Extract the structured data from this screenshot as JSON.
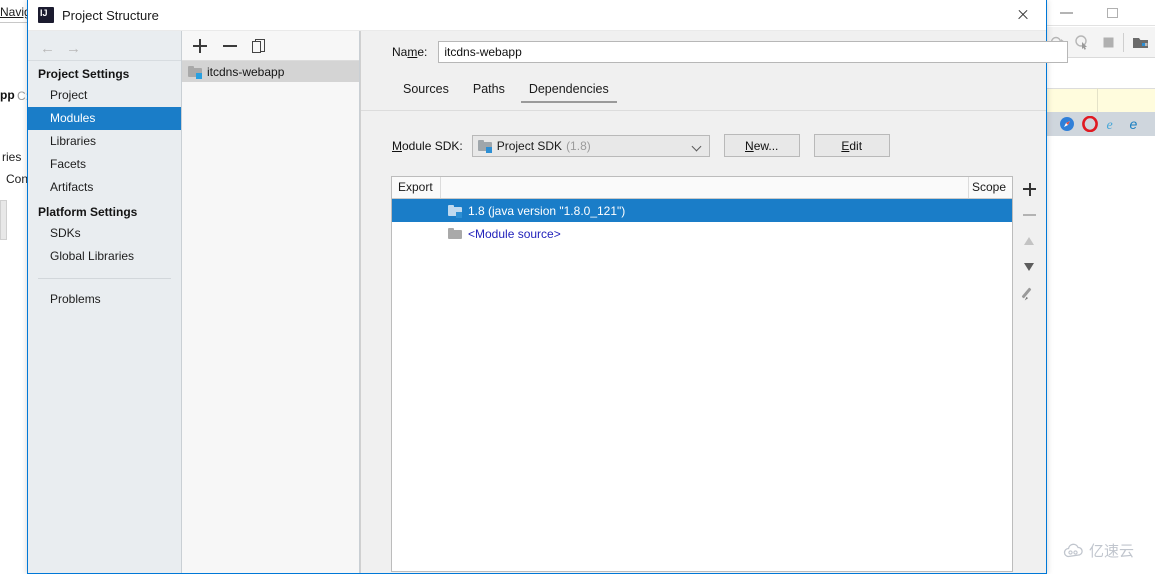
{
  "background": {
    "menu_text": "Navig",
    "bold_fragment": "pp",
    "gray_fragment": "C:",
    "fragment_libraries": "ries",
    "fragment_configure": "Con",
    "toolbar_icons": [
      "debug-step-icon",
      "debug-cursor-icon",
      "stop-icon",
      "folder-icon"
    ],
    "browsers": [
      "safari-browser-icon",
      "opera-browser-icon",
      "ie-browser-icon",
      "edge-browser-icon"
    ],
    "window_buttons": [
      "minimize-button",
      "maximize-button"
    ]
  },
  "watermark": {
    "text": "亿速云"
  },
  "dialog": {
    "title": "Project Structure",
    "close_label": "×",
    "nav": {
      "back_glyph": "←",
      "forward_glyph": "→",
      "groups": [
        {
          "heading": "Project Settings",
          "items": [
            {
              "label": "Project",
              "selected": false
            },
            {
              "label": "Modules",
              "selected": true
            },
            {
              "label": "Libraries",
              "selected": false
            },
            {
              "label": "Facets",
              "selected": false
            },
            {
              "label": "Artifacts",
              "selected": false
            }
          ]
        },
        {
          "heading": "Platform Settings",
          "items": [
            {
              "label": "SDKs",
              "selected": false
            },
            {
              "label": "Global Libraries",
              "selected": false
            }
          ]
        }
      ],
      "footer_items": [
        {
          "label": "Problems",
          "selected": false
        }
      ]
    },
    "tree": {
      "toolbar": [
        "add-module-button",
        "remove-module-button",
        "copy-module-button"
      ],
      "modules": [
        {
          "label": "itcdns-webapp",
          "selected": true
        }
      ]
    },
    "form": {
      "name_label": "Name:",
      "name_value": "itcdns-webapp",
      "name_placeholder": "",
      "tabs": [
        {
          "label": "Sources",
          "active": false
        },
        {
          "label": "Paths",
          "active": false
        },
        {
          "label": "Dependencies",
          "active": true
        }
      ],
      "sdk_label": "Module SDK:",
      "sdk_value": "Project SDK",
      "sdk_version": "(1.8)",
      "new_button": "New...",
      "edit_button": "Edit"
    },
    "table": {
      "columns": [
        "Export",
        "Scope"
      ],
      "rows": [
        {
          "label": "1.8 (java version \"1.8.0_121\")",
          "icon": "sdk-folder-icon",
          "selected": true,
          "scope": ""
        },
        {
          "label": "<Module source>",
          "icon": "module-folder-icon",
          "selected": false,
          "scope": ""
        }
      ]
    },
    "rail": [
      {
        "name": "add-dependency-button",
        "icon": "plus-icon",
        "enabled": true
      },
      {
        "name": "remove-dependency-button",
        "icon": "minus-icon",
        "enabled": false
      },
      {
        "name": "move-up-button",
        "icon": "arrow-up-icon",
        "enabled": false
      },
      {
        "name": "move-down-button",
        "icon": "arrow-down-icon",
        "enabled": true
      },
      {
        "name": "edit-dependency-button",
        "icon": "pencil-icon",
        "enabled": true
      }
    ]
  },
  "colors": {
    "accent": "#1a7dc8",
    "link": "#2222bb",
    "dialog_border": "#0078d7"
  }
}
